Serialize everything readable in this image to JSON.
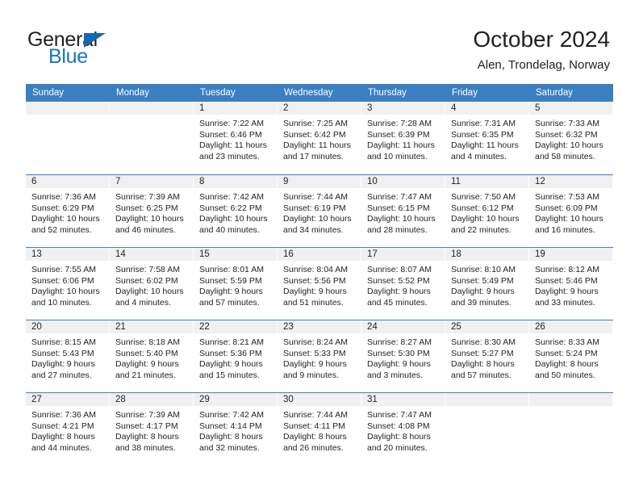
{
  "brand": {
    "name_top": "General",
    "name_bottom": "Blue",
    "accent_color": "#1b75bb",
    "triangle_color": "#1268b3"
  },
  "header": {
    "title": "October 2024",
    "subtitle": "Alen, Trondelag, Norway"
  },
  "calendar": {
    "header_bg": "#3c7fc1",
    "cell_head_bg": "#f0f0f0",
    "day_names": [
      "Sunday",
      "Monday",
      "Tuesday",
      "Wednesday",
      "Thursday",
      "Friday",
      "Saturday"
    ],
    "weeks": [
      [
        {
          "day": "",
          "lines": []
        },
        {
          "day": "",
          "lines": []
        },
        {
          "day": "1",
          "lines": [
            "Sunrise: 7:22 AM",
            "Sunset: 6:46 PM",
            "Daylight: 11 hours",
            "and 23 minutes."
          ]
        },
        {
          "day": "2",
          "lines": [
            "Sunrise: 7:25 AM",
            "Sunset: 6:42 PM",
            "Daylight: 11 hours",
            "and 17 minutes."
          ]
        },
        {
          "day": "3",
          "lines": [
            "Sunrise: 7:28 AM",
            "Sunset: 6:39 PM",
            "Daylight: 11 hours",
            "and 10 minutes."
          ]
        },
        {
          "day": "4",
          "lines": [
            "Sunrise: 7:31 AM",
            "Sunset: 6:35 PM",
            "Daylight: 11 hours",
            "and 4 minutes."
          ]
        },
        {
          "day": "5",
          "lines": [
            "Sunrise: 7:33 AM",
            "Sunset: 6:32 PM",
            "Daylight: 10 hours",
            "and 58 minutes."
          ]
        }
      ],
      [
        {
          "day": "6",
          "lines": [
            "Sunrise: 7:36 AM",
            "Sunset: 6:29 PM",
            "Daylight: 10 hours",
            "and 52 minutes."
          ]
        },
        {
          "day": "7",
          "lines": [
            "Sunrise: 7:39 AM",
            "Sunset: 6:25 PM",
            "Daylight: 10 hours",
            "and 46 minutes."
          ]
        },
        {
          "day": "8",
          "lines": [
            "Sunrise: 7:42 AM",
            "Sunset: 6:22 PM",
            "Daylight: 10 hours",
            "and 40 minutes."
          ]
        },
        {
          "day": "9",
          "lines": [
            "Sunrise: 7:44 AM",
            "Sunset: 6:19 PM",
            "Daylight: 10 hours",
            "and 34 minutes."
          ]
        },
        {
          "day": "10",
          "lines": [
            "Sunrise: 7:47 AM",
            "Sunset: 6:15 PM",
            "Daylight: 10 hours",
            "and 28 minutes."
          ]
        },
        {
          "day": "11",
          "lines": [
            "Sunrise: 7:50 AM",
            "Sunset: 6:12 PM",
            "Daylight: 10 hours",
            "and 22 minutes."
          ]
        },
        {
          "day": "12",
          "lines": [
            "Sunrise: 7:53 AM",
            "Sunset: 6:09 PM",
            "Daylight: 10 hours",
            "and 16 minutes."
          ]
        }
      ],
      [
        {
          "day": "13",
          "lines": [
            "Sunrise: 7:55 AM",
            "Sunset: 6:06 PM",
            "Daylight: 10 hours",
            "and 10 minutes."
          ]
        },
        {
          "day": "14",
          "lines": [
            "Sunrise: 7:58 AM",
            "Sunset: 6:02 PM",
            "Daylight: 10 hours",
            "and 4 minutes."
          ]
        },
        {
          "day": "15",
          "lines": [
            "Sunrise: 8:01 AM",
            "Sunset: 5:59 PM",
            "Daylight: 9 hours",
            "and 57 minutes."
          ]
        },
        {
          "day": "16",
          "lines": [
            "Sunrise: 8:04 AM",
            "Sunset: 5:56 PM",
            "Daylight: 9 hours",
            "and 51 minutes."
          ]
        },
        {
          "day": "17",
          "lines": [
            "Sunrise: 8:07 AM",
            "Sunset: 5:52 PM",
            "Daylight: 9 hours",
            "and 45 minutes."
          ]
        },
        {
          "day": "18",
          "lines": [
            "Sunrise: 8:10 AM",
            "Sunset: 5:49 PM",
            "Daylight: 9 hours",
            "and 39 minutes."
          ]
        },
        {
          "day": "19",
          "lines": [
            "Sunrise: 8:12 AM",
            "Sunset: 5:46 PM",
            "Daylight: 9 hours",
            "and 33 minutes."
          ]
        }
      ],
      [
        {
          "day": "20",
          "lines": [
            "Sunrise: 8:15 AM",
            "Sunset: 5:43 PM",
            "Daylight: 9 hours",
            "and 27 minutes."
          ]
        },
        {
          "day": "21",
          "lines": [
            "Sunrise: 8:18 AM",
            "Sunset: 5:40 PM",
            "Daylight: 9 hours",
            "and 21 minutes."
          ]
        },
        {
          "day": "22",
          "lines": [
            "Sunrise: 8:21 AM",
            "Sunset: 5:36 PM",
            "Daylight: 9 hours",
            "and 15 minutes."
          ]
        },
        {
          "day": "23",
          "lines": [
            "Sunrise: 8:24 AM",
            "Sunset: 5:33 PM",
            "Daylight: 9 hours",
            "and 9 minutes."
          ]
        },
        {
          "day": "24",
          "lines": [
            "Sunrise: 8:27 AM",
            "Sunset: 5:30 PM",
            "Daylight: 9 hours",
            "and 3 minutes."
          ]
        },
        {
          "day": "25",
          "lines": [
            "Sunrise: 8:30 AM",
            "Sunset: 5:27 PM",
            "Daylight: 8 hours",
            "and 57 minutes."
          ]
        },
        {
          "day": "26",
          "lines": [
            "Sunrise: 8:33 AM",
            "Sunset: 5:24 PM",
            "Daylight: 8 hours",
            "and 50 minutes."
          ]
        }
      ],
      [
        {
          "day": "27",
          "lines": [
            "Sunrise: 7:36 AM",
            "Sunset: 4:21 PM",
            "Daylight: 8 hours",
            "and 44 minutes."
          ]
        },
        {
          "day": "28",
          "lines": [
            "Sunrise: 7:39 AM",
            "Sunset: 4:17 PM",
            "Daylight: 8 hours",
            "and 38 minutes."
          ]
        },
        {
          "day": "29",
          "lines": [
            "Sunrise: 7:42 AM",
            "Sunset: 4:14 PM",
            "Daylight: 8 hours",
            "and 32 minutes."
          ]
        },
        {
          "day": "30",
          "lines": [
            "Sunrise: 7:44 AM",
            "Sunset: 4:11 PM",
            "Daylight: 8 hours",
            "and 26 minutes."
          ]
        },
        {
          "day": "31",
          "lines": [
            "Sunrise: 7:47 AM",
            "Sunset: 4:08 PM",
            "Daylight: 8 hours",
            "and 20 minutes."
          ]
        },
        {
          "day": "",
          "lines": []
        },
        {
          "day": "",
          "lines": []
        }
      ]
    ]
  }
}
